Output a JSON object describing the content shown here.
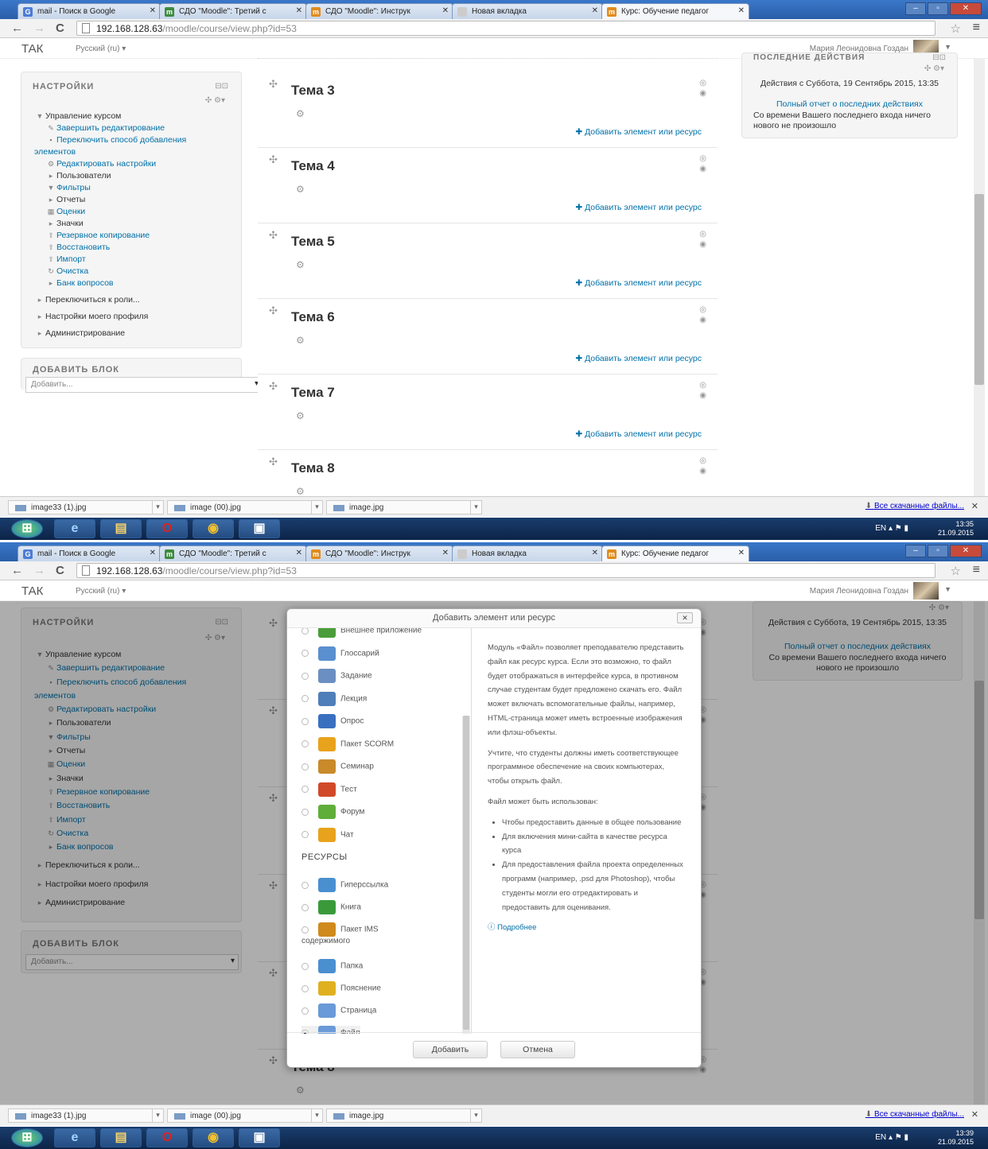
{
  "browser": {
    "tabs": [
      {
        "label": "mail - Поиск в Google",
        "icon": "google-icon",
        "color": "#4a7cd6"
      },
      {
        "label": "СДО \"Moodle\": Третий с",
        "icon": "moodle-icon",
        "color": "#3d8b3d"
      },
      {
        "label": "СДО \"Moodle\": Инструк",
        "icon": "moodle-icon",
        "color": "#e08b1c"
      },
      {
        "label": "Новая вкладка",
        "icon": "blank-tab-icon",
        "color": "#cccccc"
      },
      {
        "label": "Курс: Обучение педагог",
        "icon": "moodle-icon",
        "color": "#e08b1c"
      }
    ],
    "url_host": "192.168.128.63",
    "url_path": "/moodle/course/view.php?id=53"
  },
  "header": {
    "brand": "ТАК",
    "language": "Русский (ru) ▾",
    "user": "Мария Леонидовна Гоздан"
  },
  "settings": {
    "title": "НАСТРОЙКИ",
    "items": [
      {
        "label": "Управление курсом",
        "icon": "caret-down-icon",
        "link": false
      },
      {
        "label": "Завершить редактирование",
        "icon": "pencil-icon",
        "link": true
      },
      {
        "label": "Переключить способ добавления",
        "icon": "bullet-icon",
        "link": true
      },
      {
        "label": "элементов",
        "icon": "",
        "link": true
      },
      {
        "label": "Редактировать настройки",
        "icon": "gear-icon",
        "link": true
      },
      {
        "label": "Пользователи",
        "icon": "caret-right-icon",
        "link": false
      },
      {
        "label": "Фильтры",
        "icon": "filter-icon",
        "link": true
      },
      {
        "label": "Отчеты",
        "icon": "caret-right-icon",
        "link": false
      },
      {
        "label": "Оценки",
        "icon": "grades-icon",
        "link": true
      },
      {
        "label": "Значки",
        "icon": "caret-right-icon",
        "link": false
      },
      {
        "label": "Резервное копирование",
        "icon": "backup-icon",
        "link": true
      },
      {
        "label": "Восстановить",
        "icon": "restore-icon",
        "link": true
      },
      {
        "label": "Импорт",
        "icon": "import-icon",
        "link": true
      },
      {
        "label": "Очистка",
        "icon": "reset-icon",
        "link": true
      },
      {
        "label": "Банк вопросов",
        "icon": "caret-right-icon",
        "link": true
      }
    ],
    "more": [
      "Переключиться к роли...",
      "Настройки моего профиля",
      "Администрирование"
    ]
  },
  "add_block": {
    "title": "ДОБАВИТЬ БЛОК",
    "placeholder": "Добавить..."
  },
  "topics": [
    "Тема 3",
    "Тема 4",
    "Тема 5",
    "Тема 6",
    "Тема 7",
    "Тема 8"
  ],
  "add_activity_label": "Добавить элемент или ресурс",
  "recent": {
    "title": "ПОСЛЕДНИЕ ДЕЙСТВИЯ",
    "since": "Действия с Суббота, 19 Сентябрь 2015, 13:35",
    "report": "Полный отчет о последних действиях",
    "nothing": "Со времени Вашего последнего входа ничего нового не произошло"
  },
  "downloads": {
    "files": [
      "image33 (1).jpg",
      "image (00).jpg",
      "image.jpg"
    ],
    "all": "Все скачанные файлы..."
  },
  "taskbar": {
    "lang": "EN",
    "time1": "13:35",
    "date1": "21.09.2015",
    "time2": "13:39",
    "date2": "21.09.2015"
  },
  "dialog": {
    "title": "Добавить элемент или ресурс",
    "activities": [
      {
        "label": "Внешнее приложение",
        "icon": "external-tool-icon",
        "color": "#4a9d3a"
      },
      {
        "label": "Глоссарий",
        "icon": "glossary-icon",
        "color": "#5a8fd0"
      },
      {
        "label": "Задание",
        "icon": "assignment-icon",
        "color": "#6b8fc2"
      },
      {
        "label": "Лекция",
        "icon": "lesson-icon",
        "color": "#4f7fb8"
      },
      {
        "label": "Опрос",
        "icon": "choice-icon",
        "color": "#3a6fc0"
      },
      {
        "label": "Пакет SCORM",
        "icon": "scorm-icon",
        "color": "#e8a21c"
      },
      {
        "label": "Семинар",
        "icon": "workshop-icon",
        "color": "#c98a2a"
      },
      {
        "label": "Тест",
        "icon": "quiz-icon",
        "color": "#d04a2a"
      },
      {
        "label": "Форум",
        "icon": "forum-icon",
        "color": "#5fae3a"
      },
      {
        "label": "Чат",
        "icon": "chat-icon",
        "color": "#e8a21c"
      }
    ],
    "resources_title": "РЕСУРСЫ",
    "resources": [
      {
        "label": "Гиперссылка",
        "icon": "url-icon",
        "color": "#4a8fd0"
      },
      {
        "label": "Книга",
        "icon": "book-icon",
        "color": "#3a9a3a"
      },
      {
        "label": "Пакет IMS",
        "label2": "содержимого",
        "icon": "ims-icon",
        "color": "#d08a1c"
      },
      {
        "label": "Папка",
        "icon": "folder-icon",
        "color": "#4a8fd0"
      },
      {
        "label": "Пояснение",
        "icon": "label-icon",
        "color": "#e0b020"
      },
      {
        "label": "Страница",
        "icon": "page-icon",
        "color": "#6a9ad8"
      },
      {
        "label": "Файл",
        "icon": "file-icon",
        "color": "#6a9ad8",
        "selected": true
      }
    ],
    "desc1": "Модуль «Файл» позволяет преподавателю представить файл как ресурс курса. Если это возможно, то файл будет отображаться в интерфейсе курса, в противном случае студентам будет предложено скачать его. Файл может включать вспомогательные файлы, например, HTML-страница может иметь встроенные изображения или флэш-объекты.",
    "desc2": "Учтите, что студенты должны иметь соответствующее программное обеспечение на своих компьютерах, чтобы открыть файл.",
    "desc3": "Файл может быть использован:",
    "uses": [
      "Чтобы предоставить данные в общее пользование",
      "Для включения мини-сайта в качестве ресурса курса",
      "Для предоставления файла проекта определенных программ (например, .psd для Photoshop), чтобы студенты могли его отредактировать и предоставить для оценивания."
    ],
    "more": "Подробнее",
    "add_button": "Добавить",
    "cancel_button": "Отмена"
  }
}
